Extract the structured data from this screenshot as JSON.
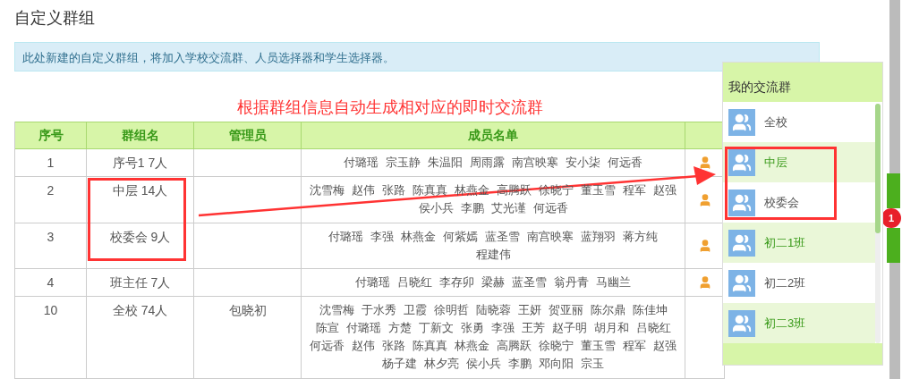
{
  "page_title": "自定义群组",
  "notice": "此处新建的自定义群组，将加入学校交流群、人员选择器和学生选择器。",
  "annotation": "根据群组信息自动生成相对应的即时交流群",
  "table": {
    "columns": [
      "序号",
      "群组名",
      "管理员",
      "成员名单"
    ],
    "rows": [
      {
        "no": "1",
        "group": "序号1 7人",
        "admin": "",
        "members": [
          "付璐瑶",
          "宗玉静",
          "朱温阳",
          "周雨露",
          "南宫映寒",
          "安小柒",
          "何远香"
        ],
        "member_icon": true
      },
      {
        "no": "2",
        "group": "中层 14人",
        "admin": "",
        "members": [
          "沈雪梅",
          "赵伟",
          "张路",
          "陈真真",
          "林燕金",
          "高腾跃",
          "徐晓宁",
          "董玉雪",
          "程军",
          "赵强",
          "侯小兵",
          "李鹏",
          "艾光谨",
          "何远香"
        ],
        "member_icon": true
      },
      {
        "no": "3",
        "group": "校委会 9人",
        "admin": "",
        "members": [
          "付璐瑶",
          "李强",
          "林燕金",
          "何紫嫣",
          "蓝圣雪",
          "南宫映寒",
          "蓝翔羽",
          "蒋方纯",
          "程建伟"
        ],
        "member_icon": true
      },
      {
        "no": "4",
        "group": "班主任 7人",
        "admin": "",
        "members": [
          "付璐瑶",
          "吕晓红",
          "李存卯",
          "梁赫",
          "蓝圣雪",
          "翁丹青",
          "马幽兰"
        ],
        "member_icon": true
      },
      {
        "no": "10",
        "group": "全校 74人",
        "admin": "包晓初",
        "members": [
          "沈雪梅",
          "于水秀",
          "卫霞",
          "徐明哲",
          "陆晓蓉",
          "王妍",
          "贺亚丽",
          "陈尔鼎",
          "陈佳坤",
          "陈宣",
          "付璐瑶",
          "方楚",
          "丁新文",
          "张勇",
          "李强",
          "王芳",
          "赵子明",
          "胡月和",
          "吕晓红",
          "何远香",
          "赵伟",
          "张路",
          "陈真真",
          "林燕金",
          "高腾跃",
          "徐晓宁",
          "董玉雪",
          "程军",
          "赵强",
          "杨子建",
          "林夕亮",
          "侯小兵",
          "李鹏",
          "邓向阳",
          "宗玉"
        ],
        "member_icon": false
      }
    ]
  },
  "chat_panel": {
    "title": "我的交流群",
    "groups": [
      "全校",
      "中层",
      "校委会",
      "初二1班",
      "初二2班",
      "初二3班"
    ]
  },
  "badge": "1"
}
